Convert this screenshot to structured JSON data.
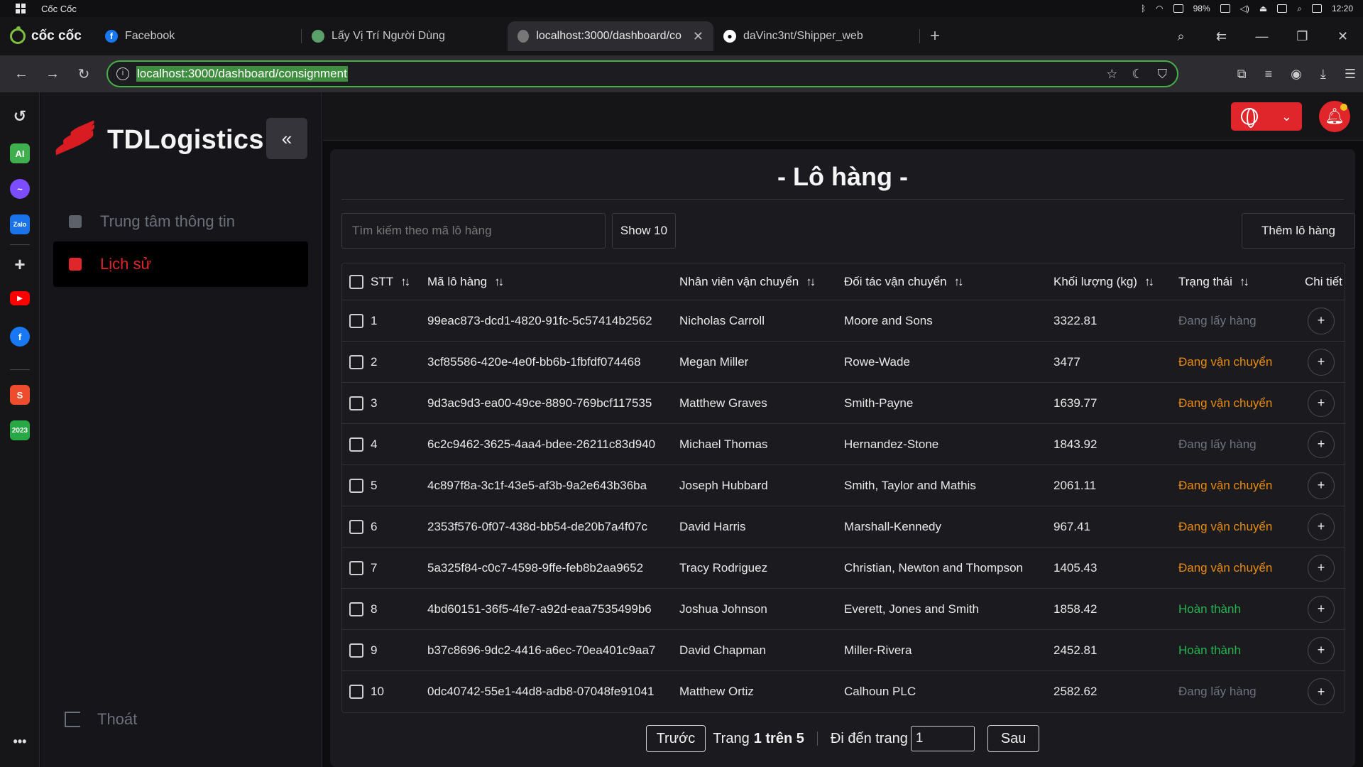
{
  "os": {
    "title": "Cốc Cốc",
    "battery": "98%",
    "time": "12:20"
  },
  "browser": {
    "brand": "cốc cốc",
    "tabs": [
      {
        "label": "Facebook",
        "favicon": "facebook-icon",
        "color": "#1877f2"
      },
      {
        "label": "Lấy Vị Trí Người Dùng",
        "favicon": "globe-icon",
        "color": "#5aa06a"
      },
      {
        "label": "localhost:3000/dashboard/co",
        "favicon": "globe-icon",
        "color": "#777777",
        "active": true
      },
      {
        "label": "daVinc3nt/Shipper_web",
        "favicon": "github-icon",
        "color": "#ffffff"
      }
    ],
    "url": "localhost:3000/dashboard/consignment",
    "accent": "#47b04a"
  },
  "sidebar": {
    "logo_text": "TDLogistics",
    "collapse_icon": "«",
    "menu": [
      {
        "label": "Trung tâm thông tin",
        "icon": "info-center-icon"
      },
      {
        "label": "Lịch sử",
        "icon": "history-archive-icon",
        "active": true
      }
    ],
    "logout_label": "Thoát",
    "brand_color": "#e0252b"
  },
  "main": {
    "title": "- Lô hàng -",
    "search_placeholder": "Tìm kiếm theo mã lô hàng",
    "show_label": "Show 10",
    "add_label": "Thêm lô hàng",
    "table": {
      "headers": {
        "stt": "STT",
        "code": "Mã lô hàng",
        "staff": "Nhân viên vận chuyển",
        "partner": "Đối tác vận chuyển",
        "mass": "Khối lượng (kg)",
        "status": "Trạng thái",
        "detail": "Chi tiết"
      },
      "rows": [
        {
          "stt": "1",
          "code": "99eac873-dcd1-4820-91fc-5c57414b2562",
          "staff": "Nicholas Carroll",
          "partner": "Moore and Sons",
          "mass": "3322.81",
          "status": "Đang lấy hàng",
          "status_type": "pick"
        },
        {
          "stt": "2",
          "code": "3cf85586-420e-4e0f-bb6b-1fbfdf074468",
          "staff": "Megan Miller",
          "partner": "Rowe-Wade",
          "mass": "3477",
          "status": "Đang vận chuyển",
          "status_type": "ship"
        },
        {
          "stt": "3",
          "code": "9d3ac9d3-ea00-49ce-8890-769bcf117535",
          "staff": "Matthew Graves",
          "partner": "Smith-Payne",
          "mass": "1639.77",
          "status": "Đang vận chuyển",
          "status_type": "ship"
        },
        {
          "stt": "4",
          "code": "6c2c9462-3625-4aa4-bdee-26211c83d940",
          "staff": "Michael Thomas",
          "partner": "Hernandez-Stone",
          "mass": "1843.92",
          "status": "Đang lấy hàng",
          "status_type": "pick"
        },
        {
          "stt": "5",
          "code": "4c897f8a-3c1f-43e5-af3b-9a2e643b36ba",
          "staff": "Joseph Hubbard",
          "partner": "Smith, Taylor and Mathis",
          "mass": "2061.11",
          "status": "Đang vận chuyển",
          "status_type": "ship"
        },
        {
          "stt": "6",
          "code": "2353f576-0f07-438d-bb54-de20b7a4f07c",
          "staff": "David Harris",
          "partner": "Marshall-Kennedy",
          "mass": "967.41",
          "status": "Đang vận chuyển",
          "status_type": "ship"
        },
        {
          "stt": "7",
          "code": "5a325f84-c0c7-4598-9ffe-feb8b2aa9652",
          "staff": "Tracy Rodriguez",
          "partner": "Christian, Newton and Thompson",
          "mass": "1405.43",
          "status": "Đang vận chuyển",
          "status_type": "ship"
        },
        {
          "stt": "8",
          "code": "4bd60151-36f5-4fe7-a92d-eaa7535499b6",
          "staff": "Joshua Johnson",
          "partner": "Everett, Jones and Smith",
          "mass": "1858.42",
          "status": "Hoàn thành",
          "status_type": "done"
        },
        {
          "stt": "9",
          "code": "b37c8696-9dc2-4416-a6ec-70ea401c9aa7",
          "staff": "David Chapman",
          "partner": "Miller-Rivera",
          "mass": "2452.81",
          "status": "Hoàn thành",
          "status_type": "done"
        },
        {
          "stt": "10",
          "code": "0dc40742-55e1-44d8-adb8-07048fe91041",
          "staff": "Matthew Ortiz",
          "partner": "Calhoun PLC",
          "mass": "2582.62",
          "status": "Đang lấy hàng",
          "status_type": "pick"
        }
      ]
    },
    "pagination": {
      "prev_label": "Trước",
      "page_prefix": "Trang",
      "page_info": "1 trên 5",
      "goto_label": "Đi đến trang",
      "goto_value": "1",
      "next_label": "Sau"
    }
  }
}
